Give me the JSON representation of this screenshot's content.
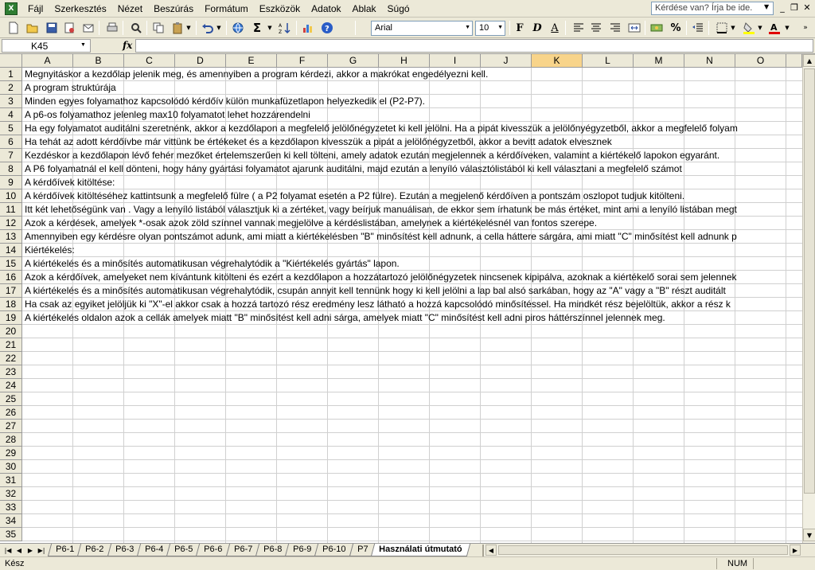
{
  "menu": {
    "app_icon": "excel-icon",
    "items": [
      "Fájl",
      "Szerkesztés",
      "Nézet",
      "Beszúrás",
      "Formátum",
      "Eszközök",
      "Adatok",
      "Ablak",
      "Súgó"
    ],
    "help_placeholder": "Kérdése van? Írja be ide."
  },
  "toolbar": {
    "font_name": "Arial",
    "font_size": "10",
    "bold_label": "F",
    "italic_label": "D",
    "underline_label": "A",
    "percent_label": "%",
    "sum_label": "Σ"
  },
  "formula_bar": {
    "name_box": "K45",
    "fx_label": "fx"
  },
  "columns": [
    "A",
    "B",
    "C",
    "D",
    "E",
    "F",
    "G",
    "H",
    "I",
    "J",
    "K",
    "L",
    "M",
    "N",
    "O"
  ],
  "active_column": "K",
  "row_numbers": [
    "1",
    "2",
    "3",
    "4",
    "5",
    "6",
    "7",
    "8",
    "9",
    "10",
    "11",
    "12",
    "13",
    "14",
    "15",
    "16",
    "17",
    "18",
    "19",
    "20",
    "21",
    "22",
    "23",
    "24",
    "25",
    "26",
    "27",
    "28",
    "29",
    "30",
    "31",
    "32",
    "33",
    "34",
    "35"
  ],
  "cells": [
    "Megnyitáskor a kezdőlap jelenik meg, és amennyiben a program kérdezi, akkor a makrókat engedélyezni kell.",
    "A program struktúrája",
    "Minden egyes folyamathoz kapcsolódó kérdőív külön munkafüzetlapon helyezkedik el (P2-P7).",
    "A p6-os folyamathoz jelenleg max10 folyamatot lehet hozzárendelni",
    "Ha egy folyamatot auditálni szeretnénk, akkor a kezdőlapon a megfelelő jelölőnégyzetet ki kell jelölni. Ha a pipát kivesszük a jelölőnyégyzetből, akkor a megfelelő folyam",
    "Ha tehát az adott kérdőívbe már vittünk be értékeket és a kezdőlapon kivesszük a pipát a jelölőnégyzetből, akkor a bevitt adatok elvesznek",
    "Kezdéskor a kezdőlapon lévő fehér mezőket értelemszerűen ki kell tölteni, amely adatok ezután megjelennek a kérdőíveken, valamint a kiértékelő lapokon egyaránt.",
    "A P6 folyamatnál el kell dönteni, hogy hány gyártási folyamatot ajarunk auditálni, majd ezután a lenyíló választólistából ki kell választani a megfelelő számot",
    "A kérdőívek kitöltése:",
    "A kérdőívek kitöltéséhez kattintsunk a megfelelő fülre ( a P2 folyamat esetén a P2 fülre). Ezután a megjelenő kérdőíven a pontszám oszlopot tudjuk kitölteni.",
    "Itt két lehetőségünk van . Vagy a lenyíló listából választjuk ki a zértéket, vagy beírjuk manuálisan, de ekkor sem írhatunk be más értéket, mint ami a lenyíló listában megt",
    "Azok a kérdések, amelyek *-osak azok zöld színnel vannak megjelölve a kérdéslistában, amelynek a kiértékelésnél van fontos szerepe.",
    "Amennyiben egy kérdésre olyan pontszámot adunk, ami miatt a kiértékelésben \"B\" minősítést kell adnunk, a cella háttere sárgára, ami miatt \"C\" minősítést kell adnunk p",
    "Kiértékelés:",
    "A kiértékelés és a minősítés automatikusan végrehalytódik a \"Kiértékelés gyártás\" lapon.",
    "Azok a kérdőívek, amelyeket nem kívántunk kitölteni és ezért a kezdőlapon a hozzátartozó jelölőnégyzetek nincsenek kipipálva, azoknak a kiértékelő sorai sem jelennek",
    "A kiértékelés és a minősítés automatikusan végrehalytódik, csupán annyit kell tennünk hogy ki kell jelölni a lap bal alsó sarkában, hogy az \"A\" vagy a \"B\" részt auditált",
    "Ha csak az egyiket jelöljük ki \"X\"-el akkor csak a hozzá tartozó rész eredmény lesz látható a hozzá kapcsolódó minősítéssel. Ha mindkét rész bejelöltük, akkor a rész k",
    "A kiértékelés oldalon azok a cellák amelyek miatt \"B\" minősítést kell adni sárga, amelyek miatt \"C\" minősítést kell adni piros háttérszínnel jelennek meg."
  ],
  "sheet_tabs": [
    "P6-1",
    "P6-2",
    "P6-3",
    "P6-4",
    "P6-5",
    "P6-6",
    "P6-7",
    "P6-8",
    "P6-9",
    "P6-10",
    "P7",
    "Használati útmutató"
  ],
  "active_sheet": "Használati útmutató",
  "status": {
    "text": "Kész",
    "num": "NUM"
  }
}
